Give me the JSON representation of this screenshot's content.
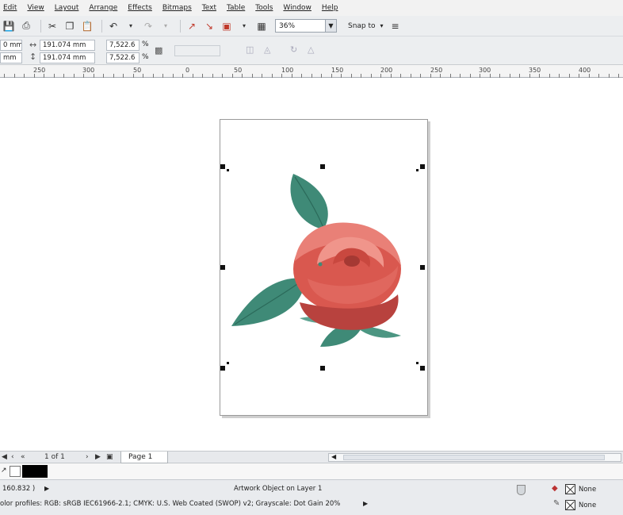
{
  "menu": [
    "Edit",
    "View",
    "Layout",
    "Arrange",
    "Effects",
    "Bitmaps",
    "Text",
    "Table",
    "Tools",
    "Window",
    "Help"
  ],
  "toolbar": {
    "zoom_value": "36%",
    "snap_label": "Snap to"
  },
  "property_bar": {
    "x_value": "0 mm",
    "y_value": "mm",
    "width_value": "191.074 mm",
    "height_value": "191.074 mm",
    "scale_x": "7,522.6",
    "scale_y": "7,522.6",
    "percent_symbol": "%"
  },
  "ruler": {
    "labels": [
      "250",
      "300",
      "50",
      "0",
      "50",
      "100",
      "150",
      "200",
      "250",
      "300",
      "350",
      "400"
    ]
  },
  "page_nav": {
    "counter": "1 of 1",
    "page_tab": "Page 1"
  },
  "status": {
    "coordinates": "160.832 )",
    "object_info": "Artwork Object on Layer 1",
    "color_profiles": "olor profiles: RGB: sRGB IEC61966-2.1; CMYK: U.S. Web Coated (SWOP) v2; Grayscale: Dot Gain 20%",
    "fill_label": "None",
    "outline_label": "None"
  },
  "colors": {
    "rose_main": "#e06a62",
    "rose_dark": "#b8423e",
    "leaf": "#3f8a77",
    "leaf_light": "#5fa492"
  }
}
